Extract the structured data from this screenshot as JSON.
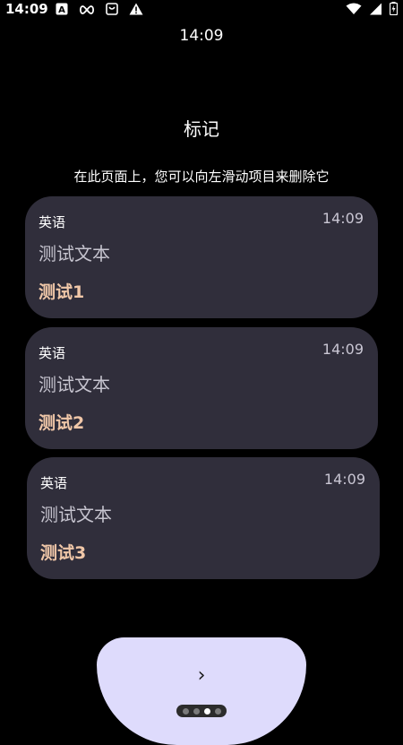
{
  "status_bar": {
    "time": "14:09",
    "icons_left": [
      "font-a-icon",
      "infinity-icon",
      "shopping-bag-icon",
      "warning-icon"
    ],
    "icons_right": [
      "wifi-icon",
      "signal-icon",
      "battery-charging-icon"
    ]
  },
  "watch_time": "14:09",
  "page": {
    "title": "标记",
    "hint": "在此页面上，您可以向左滑动项目来删除它"
  },
  "cards": [
    {
      "language": "英语",
      "time": "14:09",
      "text": "测试文本",
      "label": "测试1"
    },
    {
      "language": "英语",
      "time": "14:09",
      "text": "测试文本",
      "label": "测试2"
    },
    {
      "language": "英语",
      "time": "14:09",
      "text": "测试文本",
      "label": "测试3"
    }
  ],
  "next_button": {
    "icon": "chevron-right-icon",
    "glyph": "›"
  },
  "page_indicator": {
    "count": 4,
    "active_index": 2
  },
  "colors": {
    "background": "#000000",
    "card": "#302e3b",
    "accent_label": "#f0c7a8",
    "button": "#dedbfc"
  }
}
